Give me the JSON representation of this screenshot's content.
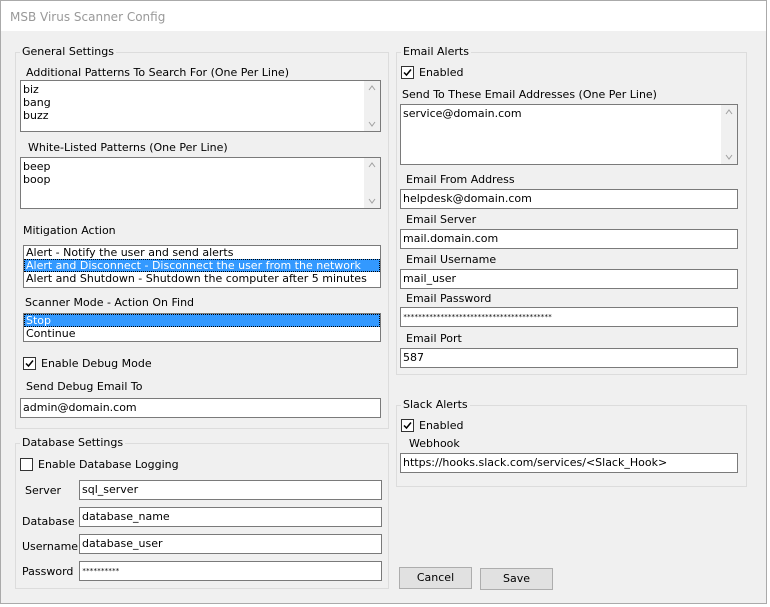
{
  "window": {
    "title": "MSB Virus Scanner Config"
  },
  "general": {
    "legend": "General Settings",
    "patterns_label": "Additional Patterns To Search For (One Per Line)",
    "patterns": [
      "biz",
      "bang",
      "buzz"
    ],
    "whitelist_label": "White-Listed Patterns (One Per Line)",
    "whitelist": [
      "beep",
      "boop"
    ],
    "mitigation_label": "Mitigation Action",
    "mitigation_options": [
      "Alert - Notify the user and send alerts",
      "Alert and Disconnect - Disconnect the user from the network",
      "Alert and Shutdown - Shutdown the computer after 5 minutes"
    ],
    "mitigation_selected": 1,
    "scanner_label": "Scanner Mode - Action On Find",
    "scanner_options": [
      "Stop",
      "Continue"
    ],
    "scanner_selected": 0,
    "debug_label": "Enable Debug Mode",
    "debug_checked": true,
    "debug_email_label": "Send Debug Email To",
    "debug_email": "admin@domain.com"
  },
  "database": {
    "legend": "Database Settings",
    "enable_label": "Enable Database Logging",
    "enable_checked": false,
    "server_label": "Server",
    "server": "sql_server",
    "database_label": "Database",
    "database": "database_name",
    "username_label": "Username",
    "username": "database_user",
    "password_label": "Password",
    "password": "**********"
  },
  "email": {
    "legend": "Email Alerts",
    "enabled_label": "Enabled",
    "enabled_checked": true,
    "addresses_label": "Send To These Email Addresses (One Per Line)",
    "addresses": [
      "service@domain.com"
    ],
    "from_label": "Email From Address",
    "from": "helpdesk@domain.com",
    "server_label": "Email Server",
    "server": "mail.domain.com",
    "username_label": "Email Username",
    "username": "mail_user",
    "password_label": "Email Password",
    "password": "****************************************",
    "port_label": "Email Port",
    "port": "587"
  },
  "slack": {
    "legend": "Slack Alerts",
    "enabled_label": "Enabled",
    "enabled_checked": true,
    "webhook_label": "Webhook",
    "webhook": "https://hooks.slack.com/services/<Slack_Hook>"
  },
  "buttons": {
    "cancel": "Cancel",
    "save": "Save"
  },
  "icons": {
    "check": "check-icon",
    "scroll_up": "chevron-up-icon",
    "scroll_down": "chevron-down-icon"
  },
  "colors": {
    "selection": "#3399ff",
    "window_bg": "#f0f0f0"
  }
}
